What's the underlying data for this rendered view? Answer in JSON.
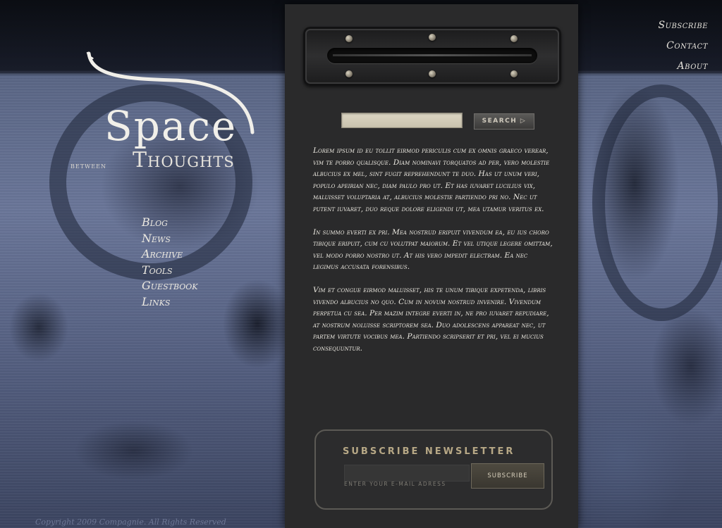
{
  "topnav": {
    "items": [
      {
        "label": "Subscribe"
      },
      {
        "label": "Contact"
      },
      {
        "label": "About"
      }
    ]
  },
  "logo": {
    "main": "Space",
    "between": "between",
    "sub": "Thoughts"
  },
  "leftnav": {
    "items": [
      {
        "label": "Blog"
      },
      {
        "label": "News"
      },
      {
        "label": "Archive"
      },
      {
        "label": "Tools"
      },
      {
        "label": "Guestbook"
      },
      {
        "label": "Links"
      }
    ]
  },
  "search": {
    "value": "",
    "button_label": "SEARCH ▷"
  },
  "content": {
    "paragraphs": [
      "Lorem ipsum id eu tollit eirmod periculis cum ex omnis graeco verear, vim te porro qualisque. Diam nominavi torquatos ad per, vero molestie albucius ex mel, sint fugit reprehendunt te duo. Has ut unum veri, populo apeirian nec, diam paulo pro ut. Et has iuvaret lucilius vix, maluisset voluptaria at, albucius molestie partiendo pri no. Nec ut putent iuvaret, duo reque dolore eligendi ut, mea utamur veritus ex.",
      "In summo everti ex pri. Mea nostrud eripuit vivendum ea, eu ius choro tibique eripuit, cum cu volutpat maiorum. Et vel utique legere omittam, vel modo porro nostro ut. At his vero impedit electram. Ea nec legimus accusata forensibus.",
      "Vim et congue eirmod maluisset, his te unum tibique expetenda, libris vivendo albucius no quo. Cum in novum nostrud invenire. Vivendum perpetua cu sea. Per mazim integre everti in, ne pro iuvaret repudiare, at nostrum noluisse scriptorem sea. Duo adolescens appareat nec, ut partem virtute vocibus mea. Partiendo scripserit et pri, vel ei mucius consequuntur."
    ]
  },
  "newsletter": {
    "title": "SUBSCRIBE NEWSLETTER",
    "input_value": "",
    "hint": "ENTER YOUR E-MAIL ADRESS",
    "button_label": "SUBSCRIBE"
  },
  "footer": {
    "text": "Copyright 2009 Compagnie. All Rights Reserved"
  }
}
